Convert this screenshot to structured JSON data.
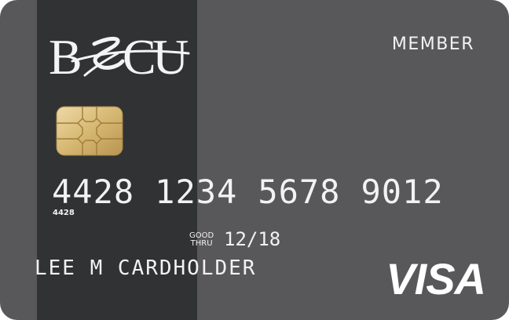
{
  "card": {
    "brand_logo_text": "BECU",
    "tier_label": "MEMBER",
    "number_groups": [
      "4428",
      "1234",
      "5678",
      "9012"
    ],
    "number_prefix_small": "4428",
    "good_thru_label_line1": "GOOD",
    "good_thru_label_line2": "THRU",
    "expiry": "12/18",
    "cardholder_name": "LEE M CARDHOLDER",
    "network": "VISA"
  },
  "colors": {
    "card_body": "#58585a",
    "left_stripe": "#303234",
    "text": "#f2f2f2",
    "chip_gold": "#d9bd7c"
  },
  "icons": {
    "chip": "emv-chip-icon",
    "logo": "becu-logo"
  }
}
